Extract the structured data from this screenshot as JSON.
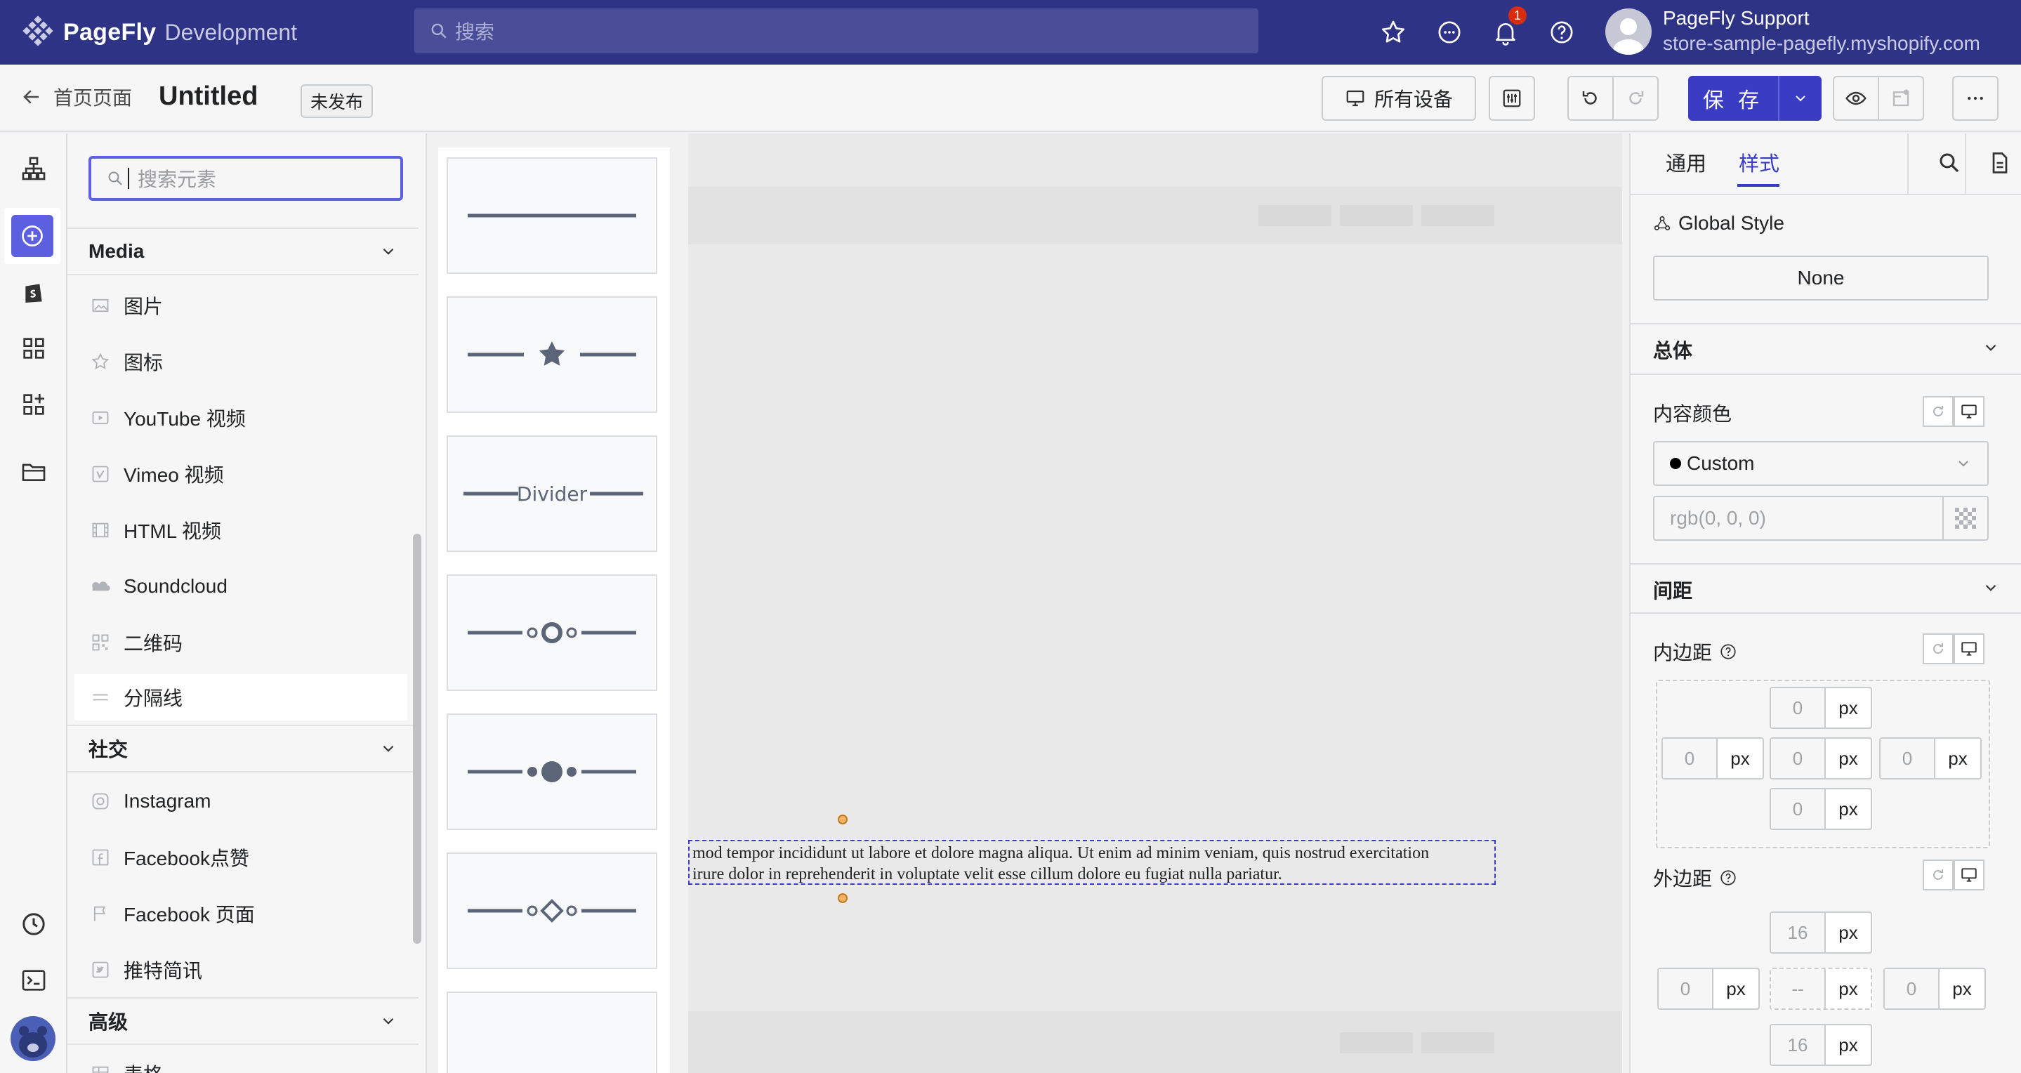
{
  "topbar": {
    "brand": "PageFly",
    "env": "Development",
    "search_placeholder": "搜索",
    "notification_count": "1",
    "user_name": "PageFly Support",
    "user_store": "store-sample-pagefly.myshopify.com",
    "bg_color": "#2f3386"
  },
  "subbar": {
    "back_label": "首页页面",
    "page_title": "Untitled",
    "status": "未发布",
    "devices_label": "所有设备",
    "save_label": "保 存",
    "accent_color": "#3a3cc4"
  },
  "element_panel": {
    "search_placeholder": "搜索元素",
    "sections": [
      {
        "title": "Media",
        "items": [
          {
            "label": "图片",
            "icon": "image-icon"
          },
          {
            "label": "图标",
            "icon": "star-icon"
          },
          {
            "label": "YouTube 视频",
            "icon": "video-icon"
          },
          {
            "label": "Vimeo 视频",
            "icon": "vimeo-icon"
          },
          {
            "label": "HTML 视频",
            "icon": "film-icon"
          },
          {
            "label": "Soundcloud",
            "icon": "cloud-icon"
          },
          {
            "label": "二维码",
            "icon": "qr-icon"
          },
          {
            "label": "分隔线",
            "icon": "divider-icon",
            "selected": true
          }
        ]
      },
      {
        "title": "社交",
        "items": [
          {
            "label": "Instagram",
            "icon": "instagram-icon"
          },
          {
            "label": "Facebook点赞",
            "icon": "facebook-icon"
          },
          {
            "label": "Facebook 页面",
            "icon": "flag-icon"
          },
          {
            "label": "推特简讯",
            "icon": "twitter-icon"
          }
        ]
      },
      {
        "title": "高级",
        "items": [
          {
            "label": "表格",
            "icon": "table-icon"
          }
        ]
      }
    ]
  },
  "divider_palette": {
    "cards": [
      {
        "variant": "plain-line"
      },
      {
        "variant": "star-center"
      },
      {
        "variant": "text-center",
        "text": "Divider"
      },
      {
        "variant": "ring-dots"
      },
      {
        "variant": "filled-dots"
      },
      {
        "variant": "diamond-outline"
      },
      {
        "variant": "diamond-filled"
      }
    ]
  },
  "canvas": {
    "text_line1": "mod tempor incididunt ut labore et dolore magna aliqua. Ut enim ad minim veniam, quis nostrud exercitation",
    "text_line2": "irure dolor in reprehenderit in voluptate velit esse cillum dolore eu fugiat nulla pariatur."
  },
  "inspector": {
    "tabs": [
      "通用",
      "样式"
    ],
    "active_tab": "样式",
    "global_style_label": "Global Style",
    "global_style_value": "None",
    "section_general": "总体",
    "content_color_label": "内容颜色",
    "color_mode": "Custom",
    "color_placeholder": "rgb(0, 0, 0)",
    "section_spacing": "间距",
    "padding_label": "内边距",
    "margin_label": "外边距",
    "unit": "px",
    "padding": {
      "top": "0",
      "left": "0",
      "center": "0",
      "right": "0",
      "bottom": "0"
    },
    "margin": {
      "top": "16",
      "left": "0",
      "center": "--",
      "right": "0",
      "bottom": "16"
    }
  }
}
